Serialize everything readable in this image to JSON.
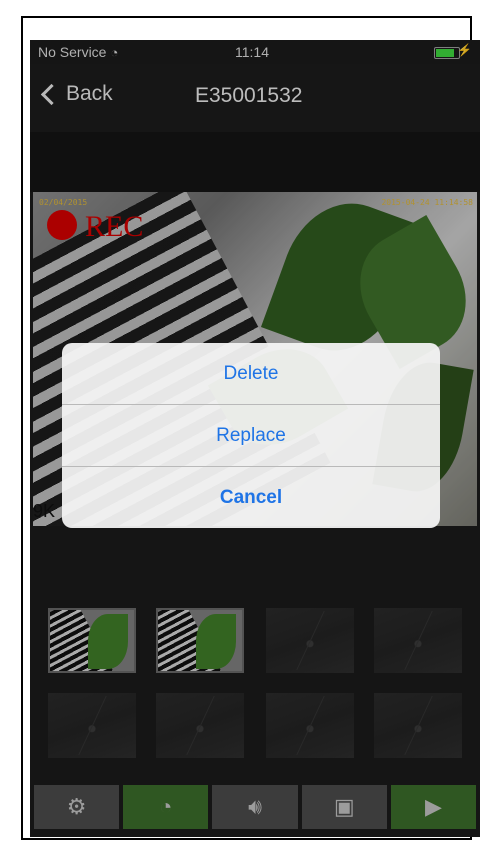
{
  "status_bar": {
    "carrier": "No Service",
    "time": "11:14",
    "battery_level": 0.85
  },
  "nav": {
    "back_label": "Back",
    "title": "E35001532"
  },
  "video": {
    "timestamp_left": "02/04/2015",
    "timestamp_right": "2015-04-24 11:14:58",
    "rec_label": "REC",
    "bitrate_label": "9K"
  },
  "thumbnails": [
    {
      "state": "snapshot"
    },
    {
      "state": "snapshot"
    },
    {
      "state": "empty"
    },
    {
      "state": "empty"
    },
    {
      "state": "empty"
    },
    {
      "state": "empty"
    },
    {
      "state": "empty"
    },
    {
      "state": "empty"
    }
  ],
  "toolbar": [
    {
      "icon": "ptz-settings-icon",
      "active": false
    },
    {
      "icon": "speedometer-icon",
      "active": true
    },
    {
      "icon": "speaker-icon",
      "active": false
    },
    {
      "icon": "camera-icon",
      "active": false
    },
    {
      "icon": "video-camera-icon",
      "active": true
    }
  ],
  "alert": {
    "options": [
      "Delete",
      "Replace",
      "Cancel"
    ]
  },
  "colors": {
    "accent_blue": "#1f74e6",
    "rec_red": "#d10000",
    "active_green": "#3a6b2a"
  }
}
